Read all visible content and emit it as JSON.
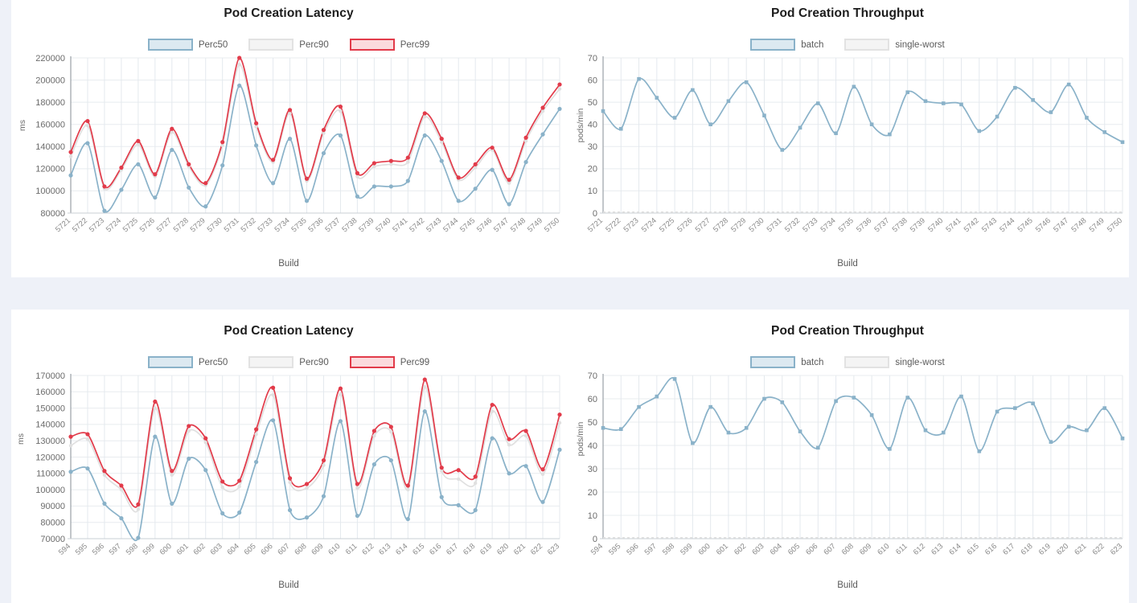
{
  "page": {
    "background": "#eef1f8",
    "panel_background": "#ffffff"
  },
  "colors": {
    "perc50": "#8ab2c9",
    "perc90": "#e0e0e0",
    "perc99": "#e23b4a",
    "batch": "#8ab2c9",
    "single_worst": "#e0e0e0",
    "title": "#1c1c1c",
    "grid": "#e8ecef"
  },
  "panels": [
    {
      "id": "top",
      "charts": [
        "latency_top",
        "throughput_top"
      ]
    },
    {
      "id": "bottom",
      "charts": [
        "latency_bottom",
        "throughput_bottom"
      ]
    }
  ],
  "chart_data": [
    {
      "id": "latency_top",
      "type": "line",
      "title": "Pod Creation Latency",
      "xlabel": "Build",
      "ylabel": "ms",
      "ylim": [
        80000,
        220000
      ],
      "yticks": [
        80000,
        100000,
        120000,
        140000,
        160000,
        180000,
        200000,
        220000
      ],
      "grid": true,
      "legend_position": "top-center",
      "legend": [
        "Perc50",
        "Perc90",
        "Perc99"
      ],
      "categories": [
        "5721",
        "5722",
        "5723",
        "5724",
        "5725",
        "5726",
        "5727",
        "5728",
        "5729",
        "5730",
        "5731",
        "5732",
        "5733",
        "5734",
        "5735",
        "5736",
        "5737",
        "5738",
        "5739",
        "5740",
        "5741",
        "5742",
        "5743",
        "5744",
        "5745",
        "5746",
        "5747",
        "5748",
        "5749",
        "5750"
      ],
      "series": [
        {
          "name": "Perc50",
          "color": "#8ab2c9",
          "values": [
            114000,
            143000,
            82000,
            101000,
            124000,
            94000,
            137000,
            103000,
            86000,
            123000,
            195000,
            141000,
            107000,
            147000,
            91000,
            134000,
            150000,
            95000,
            104000,
            104000,
            109000,
            150000,
            127000,
            91000,
            102000,
            119000,
            88000,
            126000,
            151000,
            174000
          ]
        },
        {
          "name": "Perc90",
          "color": "#e0e0e0",
          "values": [
            131000,
            159000,
            102000,
            119000,
            142000,
            113000,
            153000,
            122000,
            105000,
            141000,
            214000,
            158000,
            126000,
            170000,
            109000,
            152000,
            172000,
            113000,
            122000,
            124000,
            126000,
            167000,
            144000,
            110000,
            121000,
            137000,
            107000,
            145000,
            172000,
            192000
          ]
        },
        {
          "name": "Perc99",
          "color": "#e23b4a",
          "values": [
            135000,
            163000,
            104000,
            121000,
            145000,
            115000,
            156000,
            124000,
            107000,
            144000,
            220000,
            161000,
            128000,
            173000,
            111000,
            155000,
            176000,
            116000,
            125000,
            127000,
            130000,
            170000,
            147000,
            112000,
            124000,
            139000,
            110000,
            148000,
            175000,
            196000
          ]
        }
      ]
    },
    {
      "id": "throughput_top",
      "type": "line",
      "title": "Pod Creation Throughput",
      "xlabel": "Build",
      "ylabel": "pods/min",
      "ylim": [
        0,
        70
      ],
      "yticks": [
        0,
        10,
        20,
        30,
        40,
        50,
        60,
        70
      ],
      "grid": true,
      "legend_position": "top-center",
      "legend": [
        "batch",
        "single-worst"
      ],
      "categories": [
        "5721",
        "5722",
        "5723",
        "5724",
        "5725",
        "5726",
        "5727",
        "5728",
        "5729",
        "5730",
        "5731",
        "5732",
        "5733",
        "5734",
        "5735",
        "5736",
        "5737",
        "5738",
        "5739",
        "5740",
        "5741",
        "5742",
        "5743",
        "5744",
        "5745",
        "5746",
        "5747",
        "5748",
        "5749",
        "5750"
      ],
      "series": [
        {
          "name": "batch",
          "color": "#8ab2c9",
          "values": [
            46,
            38,
            60.5,
            52,
            43,
            55.5,
            40,
            50.5,
            59,
            44,
            28.5,
            38.5,
            49.5,
            36,
            57,
            40,
            35.5,
            54.5,
            50.5,
            49.5,
            49,
            37,
            43.5,
            56.5,
            51,
            45.5,
            58,
            43,
            36.5,
            32
          ]
        },
        {
          "name": "single-worst",
          "color": "#e0e0e0",
          "values": [
            0.4,
            0.4,
            0.4,
            0.4,
            0.4,
            0.4,
            0.4,
            0.4,
            0.4,
            0.4,
            0.4,
            0.4,
            0.4,
            0.4,
            0.4,
            0.4,
            0.4,
            0.4,
            0.4,
            0.4,
            0.4,
            0.4,
            0.4,
            0.4,
            0.4,
            0.4,
            0.4,
            0.4,
            0.4,
            0.4
          ]
        }
      ]
    },
    {
      "id": "latency_bottom",
      "type": "line",
      "title": "Pod Creation Latency",
      "xlabel": "Build",
      "ylabel": "ms",
      "ylim": [
        70000,
        170000
      ],
      "yticks": [
        70000,
        80000,
        90000,
        100000,
        110000,
        120000,
        130000,
        140000,
        150000,
        160000,
        170000
      ],
      "grid": true,
      "legend_position": "top-center",
      "legend": [
        "Perc50",
        "Perc90",
        "Perc99"
      ],
      "categories": [
        "594",
        "595",
        "596",
        "597",
        "598",
        "599",
        "600",
        "601",
        "602",
        "603",
        "604",
        "605",
        "606",
        "607",
        "608",
        "609",
        "610",
        "611",
        "612",
        "613",
        "614",
        "615",
        "616",
        "617",
        "618",
        "619",
        "620",
        "621",
        "622",
        "623"
      ],
      "series": [
        {
          "name": "Perc50",
          "color": "#8ab2c9",
          "values": [
            111000,
            113000,
            91500,
            82500,
            70500,
            132500,
            91500,
            119000,
            112000,
            85500,
            86000,
            117000,
            142500,
            87500,
            83000,
            96000,
            142000,
            84000,
            115500,
            118000,
            82000,
            148000,
            95500,
            90500,
            87500,
            131500,
            110000,
            114500,
            92500,
            124500
          ]
        },
        {
          "name": "Perc90",
          "color": "#e0e0e0",
          "values": [
            127000,
            131000,
            109000,
            100000,
            88000,
            150000,
            109000,
            136000,
            129000,
            101500,
            102000,
            134000,
            158000,
            104500,
            101000,
            115000,
            158500,
            101000,
            133000,
            135500,
            100000,
            163000,
            111500,
            106500,
            104000,
            148000,
            127500,
            133000,
            109500,
            141000
          ]
        },
        {
          "name": "Perc99",
          "color": "#e23b4a",
          "values": [
            132500,
            134000,
            111500,
            102500,
            91000,
            154000,
            111500,
            139000,
            131500,
            105000,
            105500,
            137000,
            162500,
            107000,
            103500,
            118000,
            162000,
            103500,
            136000,
            138500,
            102500,
            167500,
            113500,
            112000,
            108000,
            152000,
            131000,
            136000,
            112500,
            146000
          ]
        }
      ]
    },
    {
      "id": "throughput_bottom",
      "type": "line",
      "title": "Pod Creation Throughput",
      "xlabel": "Build",
      "ylabel": "pods/min",
      "ylim": [
        0,
        70
      ],
      "yticks": [
        0,
        10,
        20,
        30,
        40,
        50,
        60,
        70
      ],
      "grid": true,
      "legend_position": "top-center",
      "legend": [
        "batch",
        "single-worst"
      ],
      "categories": [
        "594",
        "595",
        "596",
        "597",
        "598",
        "599",
        "600",
        "601",
        "602",
        "603",
        "604",
        "605",
        "606",
        "607",
        "608",
        "609",
        "610",
        "611",
        "612",
        "613",
        "614",
        "615",
        "616",
        "617",
        "618",
        "619",
        "620",
        "621",
        "622",
        "623"
      ],
      "series": [
        {
          "name": "batch",
          "color": "#8ab2c9",
          "values": [
            47.5,
            47,
            56.5,
            61,
            68.5,
            41,
            56.5,
            45.5,
            47.5,
            60,
            58.5,
            46,
            39,
            59,
            60.5,
            53,
            38.5,
            60.5,
            46.5,
            45.5,
            61,
            37.5,
            54.5,
            56,
            58,
            41.5,
            48,
            46.5,
            56,
            43
          ]
        },
        {
          "name": "single-worst",
          "color": "#e0e0e0",
          "values": [
            0.4,
            0.4,
            0.4,
            0.4,
            0.4,
            0.4,
            0.4,
            0.4,
            0.4,
            0.4,
            0.4,
            0.4,
            0.4,
            0.4,
            0.4,
            0.4,
            0.4,
            0.4,
            0.4,
            0.4,
            0.4,
            0.4,
            0.4,
            0.4,
            0.4,
            0.4,
            0.4,
            0.4,
            0.4,
            0.4
          ]
        }
      ]
    }
  ]
}
